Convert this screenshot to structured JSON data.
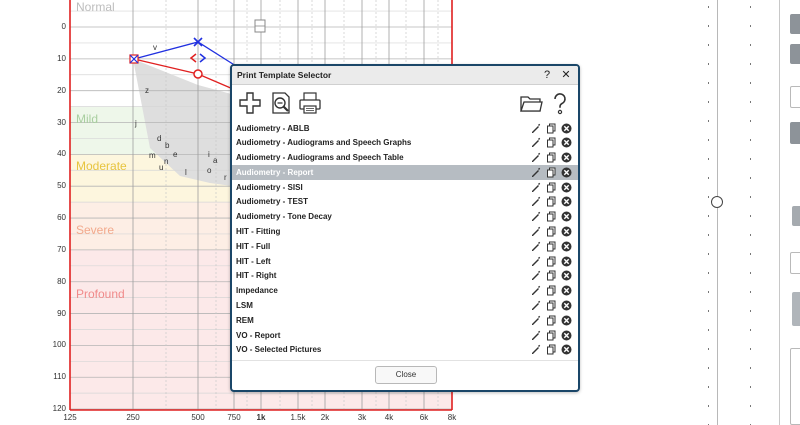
{
  "audiogram": {
    "y_ticks": [
      "0",
      "10",
      "20",
      "30",
      "40",
      "50",
      "60",
      "70",
      "80",
      "90",
      "100",
      "110",
      "120"
    ],
    "x_ticks": [
      {
        "label": "125",
        "bold": false
      },
      {
        "label": "250",
        "bold": false
      },
      {
        "label": "500",
        "bold": false
      },
      {
        "label": "750",
        "bold": false
      },
      {
        "label": "1k",
        "bold": true
      },
      {
        "label": "1.5k",
        "bold": false
      },
      {
        "label": "2k",
        "bold": false
      },
      {
        "label": "3k",
        "bold": false
      },
      {
        "label": "4k",
        "bold": false
      },
      {
        "label": "6k",
        "bold": false
      },
      {
        "label": "8k",
        "bold": false
      }
    ],
    "bands": [
      {
        "label": "Normal",
        "color": "#bdbdbd"
      },
      {
        "label": "Mild",
        "color": "#a9cfa0"
      },
      {
        "label": "Moderate",
        "color": "#e7c43e"
      },
      {
        "label": "Severe",
        "color": "#f2a98c"
      },
      {
        "label": "Profound",
        "color": "#f08a8a"
      }
    ],
    "speech_sounds": [
      "v",
      "z",
      "j",
      "d",
      "b",
      "e",
      "m",
      "n",
      "u",
      "l",
      "i",
      "a",
      "o",
      "r"
    ]
  },
  "dialog": {
    "title": "Print Template Selector",
    "help_label": "?",
    "close_label": "✕",
    "close_button": "Close",
    "templates": [
      {
        "name": "Audiometry - ABLB",
        "selected": false
      },
      {
        "name": "Audiometry - Audiograms and Speech Graphs",
        "selected": false
      },
      {
        "name": "Audiometry - Audiograms and Speech Table",
        "selected": false
      },
      {
        "name": "Audiometry - Report",
        "selected": true
      },
      {
        "name": "Audiometry - SISI",
        "selected": false
      },
      {
        "name": "Audiometry - TEST",
        "selected": false
      },
      {
        "name": "Audiometry - Tone Decay",
        "selected": false
      },
      {
        "name": "HIT - Fitting",
        "selected": false
      },
      {
        "name": "HIT - Full",
        "selected": false
      },
      {
        "name": "HIT - Left",
        "selected": false
      },
      {
        "name": "HIT - Right",
        "selected": false
      },
      {
        "name": "Impedance",
        "selected": false
      },
      {
        "name": "LSM",
        "selected": false
      },
      {
        "name": "REM",
        "selected": false
      },
      {
        "name": "VO - Report",
        "selected": false
      },
      {
        "name": "VO - Selected Pictures",
        "selected": false
      }
    ],
    "toolbar": [
      "add-icon",
      "preview-icon",
      "print-icon",
      "open-folder-icon",
      "help-icon"
    ]
  }
}
